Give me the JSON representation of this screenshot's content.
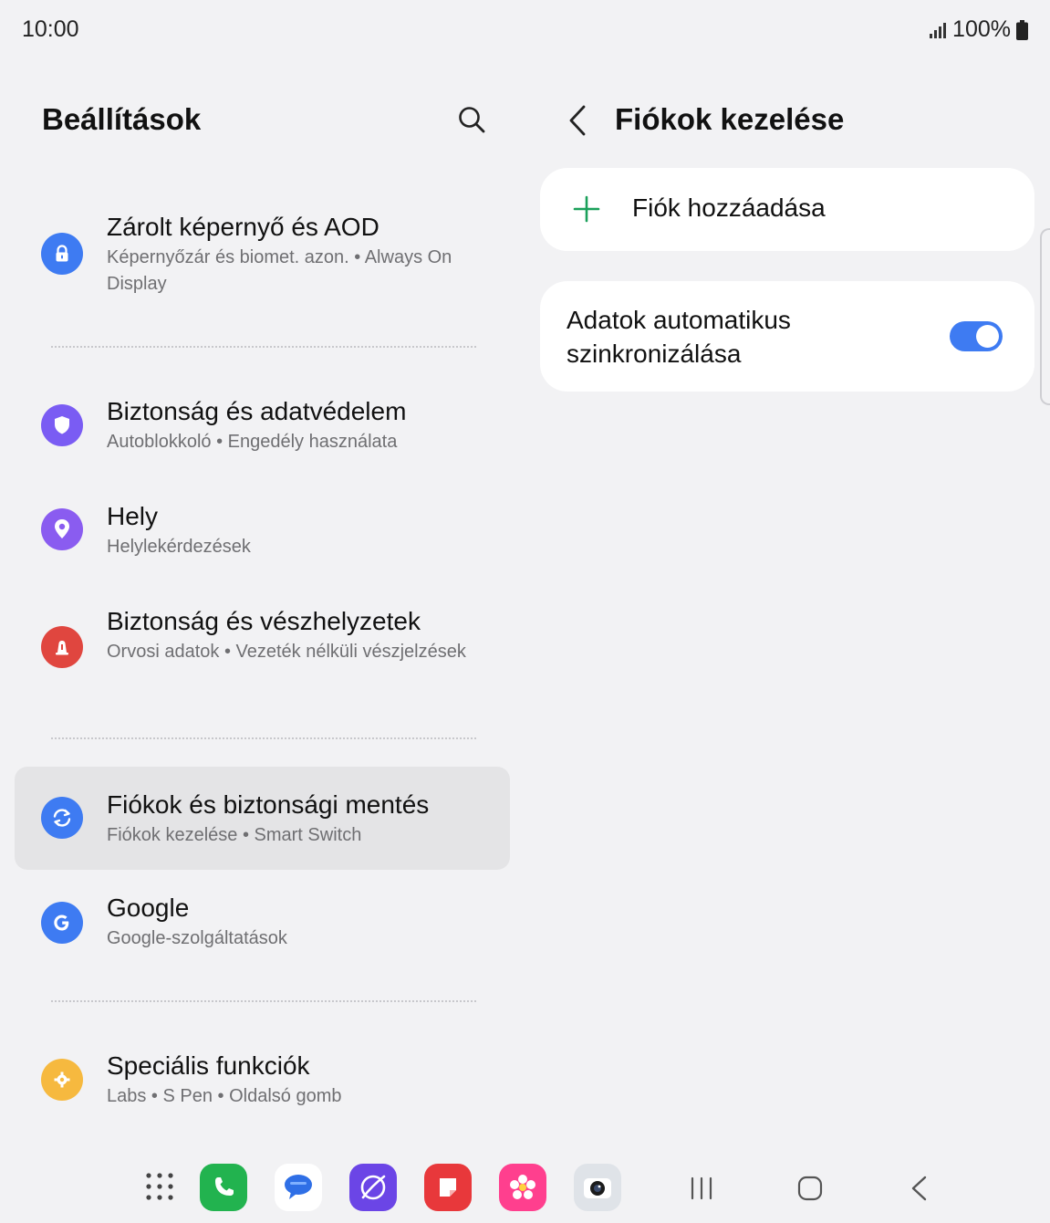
{
  "status_bar": {
    "time": "10:00",
    "battery": "100%"
  },
  "left_pane": {
    "title": "Beállítások",
    "items": [
      {
        "title": "Zárolt képernyő és AOD",
        "subtitle": "Képernyőzár és biomet. azon.  •  Always On Display",
        "icon": "lock-icon",
        "color": "#3e7bf2"
      },
      {
        "title": "Biztonság és adatvédelem",
        "subtitle": "Autoblokkoló  •  Engedély használata",
        "icon": "shield-icon",
        "color": "#7a5cf3"
      },
      {
        "title": "Hely",
        "subtitle": "Helylekérdezések",
        "icon": "location-pin-icon",
        "color": "#8a5cf0"
      },
      {
        "title": "Biztonság és vészhelyzetek",
        "subtitle": "Orvosi adatok  •  Vezeték nélküli vészjelzések",
        "icon": "emergency-siren-icon",
        "color": "#e0463f"
      },
      {
        "title": "Fiókok és biztonsági mentés",
        "subtitle": "Fiókok kezelése  •  Smart Switch",
        "icon": "sync-icon",
        "color": "#3e7bf2"
      },
      {
        "title": "Google",
        "subtitle": "Google-szolgáltatások",
        "icon": "google-icon",
        "color": "#3e7bf2"
      },
      {
        "title": "Speciális funkciók",
        "subtitle": "Labs  •  S Pen  •  Oldalsó gomb",
        "icon": "puzzle-gear-icon",
        "color": "#f6b93f"
      }
    ]
  },
  "right_pane": {
    "title": "Fiókok kezelése",
    "add_account_label": "Fiók hozzáadása",
    "auto_sync_label": "Adatok automatikus szinkronizálása",
    "auto_sync_enabled": true
  },
  "colors": {
    "accent": "#3e7bf2",
    "plus_green": "#1aa05a",
    "background": "#f2f2f4"
  }
}
